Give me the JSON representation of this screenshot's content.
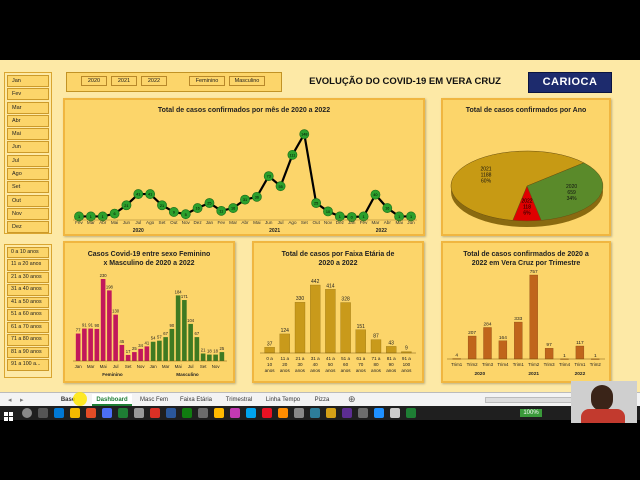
{
  "title": "EVOLUÇÃO DO COVID-19 EM VERA CRUZ",
  "logo": "CARIOCA",
  "year_buttons": [
    "2020",
    "2021",
    "2022"
  ],
  "sex_buttons": [
    "Feminino",
    "Masculino"
  ],
  "month_slicer": [
    "Jan",
    "Fev",
    "Mar",
    "Abr",
    "Mai",
    "Jun",
    "Jul",
    "Ago",
    "Set",
    "Out",
    "Nov",
    "Dez"
  ],
  "age_slicer": [
    "0 a 10 anos",
    "11 a 20 anos",
    "21 a 30 anos",
    "31 a 40 anos",
    "41 a 50 anos",
    "51 a 60 anos",
    "61 a 70 anos",
    "71 a 80 anos",
    "81 a 90 anos",
    "91 a 100 a..."
  ],
  "sheet_tabs": [
    "Base Dados",
    "Dashboard",
    "Masc Fem",
    "Faixa Etária",
    "Trimestral",
    "Linha Tempo",
    "Pizza"
  ],
  "zoom": "100%",
  "colors": {
    "accent": "#fcd56a",
    "line": "#000000",
    "marker": "#2ca02c",
    "female": "#c2185b",
    "male": "#3f7a22",
    "bar_gold": "#d4a017",
    "bar_brown": "#c0651b"
  },
  "chart_data": [
    {
      "type": "line",
      "title": "Total de casos confirmados por mês de 2020 a 2022",
      "x": [
        "Fev",
        "Mar",
        "Abr",
        "Mai",
        "Jun",
        "Jul",
        "Ago",
        "Set",
        "Out",
        "Nov",
        "Dez",
        "Jan",
        "Fev",
        "Mar",
        "Abr",
        "Mai",
        "Jun",
        "Jul",
        "Ago",
        "Set",
        "Out",
        "Nov",
        "Dez",
        "Jan",
        "Fev",
        "Mar",
        "Abr",
        "Mai",
        "Jun"
      ],
      "values": [
        1,
        1,
        1,
        6,
        21,
        41,
        41,
        21,
        9,
        5,
        16,
        25,
        11,
        16,
        31,
        36,
        73,
        55,
        111,
        148,
        25,
        10,
        1,
        0,
        1,
        40,
        16,
        1,
        1
      ],
      "year_groups": [
        {
          "label": "2020",
          "from": 0,
          "to": 10
        },
        {
          "label": "2021",
          "from": 11,
          "to": 22
        },
        {
          "label": "2022",
          "from": 23,
          "to": 28
        }
      ]
    },
    {
      "type": "pie",
      "title": "Total de casos confirmados por Ano",
      "slices": [
        {
          "label": "2020",
          "value": 659,
          "percent": "34%",
          "color": "#5a8a2a"
        },
        {
          "label": "2021",
          "value": 1188,
          "percent": "60%",
          "color": "#c79a14"
        },
        {
          "label": "2022",
          "value": 118,
          "percent": "6%",
          "color": "#e00000"
        }
      ]
    },
    {
      "type": "bar",
      "title": "Casos Covid-19 entre sexo Feminino x Masculino de 2020 a 2022",
      "categories": [
        "Jan",
        "Fev",
        "Mar",
        "Abr",
        "Mai",
        "Jun",
        "Jul",
        "Ago",
        "Set",
        "Out",
        "Nov",
        "Dez",
        "Jan",
        "Fev",
        "Mar",
        "Abr",
        "Mai",
        "Jun",
        "Jul",
        "Ago",
        "Set",
        "Out",
        "Nov",
        "Dez"
      ],
      "group_labels": [
        "Feminino",
        "Masculino"
      ],
      "values": [
        77,
        91,
        91,
        90,
        230,
        198,
        130,
        45,
        17,
        25,
        34,
        41,
        54,
        57,
        67,
        90,
        184,
        171,
        104,
        67,
        21,
        18,
        18,
        25
      ],
      "tick_labels": [
        "Jan",
        "Mar",
        "Mai",
        "Jul",
        "Set",
        "Nov",
        "Jan",
        "Mar",
        "Mai",
        "Jul",
        "Set",
        "Nov"
      ]
    },
    {
      "type": "bar",
      "title": "Total de casos por Faixa Etária de 2020 a 2022",
      "categories": [
        "0 a 10 anos",
        "11 a 20 anos",
        "21 a 30 anos",
        "31 a 40 anos",
        "41 a 50 anos",
        "51 a 60 anos",
        "61 a 70 anos",
        "71 a 80 anos",
        "81 a 90 anos",
        "91 a 100 anos"
      ],
      "values": [
        37,
        124,
        330,
        442,
        414,
        328,
        151,
        87,
        43,
        9
      ]
    },
    {
      "type": "bar",
      "title": "Total de casos confirmados de 2020 a 2022 em Vera Cruz por Trimestre",
      "categories": [
        "Trim1",
        "Trim2",
        "Trim3",
        "Trim4",
        "Trim1",
        "Trim2",
        "Trim3",
        "Trim4",
        "Trim1",
        "Trim2"
      ],
      "year_labels": [
        "2020",
        "2021",
        "2022"
      ],
      "values": [
        4,
        207,
        284,
        164,
        333,
        757,
        97,
        1,
        117,
        1
      ]
    }
  ]
}
